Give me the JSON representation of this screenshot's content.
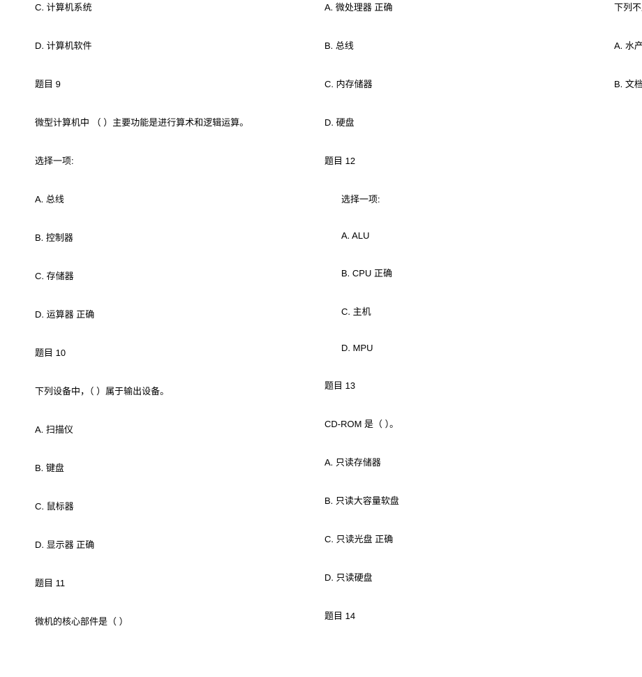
{
  "lines": [
    "C.  计算机系统",
    "D.  计算机软件",
    "题目  9",
    "微型计算机中 （  ）主要功能是进行算术和逻辑运算。",
    "选择一项:",
    "A.  总线",
    "B.  控制器",
    "C.  存储器",
    "D.  运算器  正确",
    "题目  10",
    "下列设备中，（  ）属于输出设备。",
    "A.  扫描仪",
    "B.  键盘",
    "C.  鼠标器",
    "D.  显示器  正确",
    "题目  11",
    "微机的核心部件是（  ）",
    "A.  微处理器  正确",
    "B.  总线",
    "C.  内存储器",
    "D.  硬盘",
    "题目  12",
    "选择一项:",
    "A.  ALU",
    "B.  CPU 正确",
    "C.  主机",
    "D.  MPU",
    "题目  13",
    "CD-ROM 是（  ）。",
    "A.  只读存储器",
    "B.  只读大容量软盘",
    "C.  只读光盘  正确",
    "D.  只读硬盘",
    "题目  14",
    "下列不属于计算机应用范畴的是（  ）",
    "A.  水产捕捞  正确",
    "B.  文档和网页制作"
  ],
  "col2_start_index": 18,
  "col2_indent_start": 22,
  "col2_indent_end": 26
}
